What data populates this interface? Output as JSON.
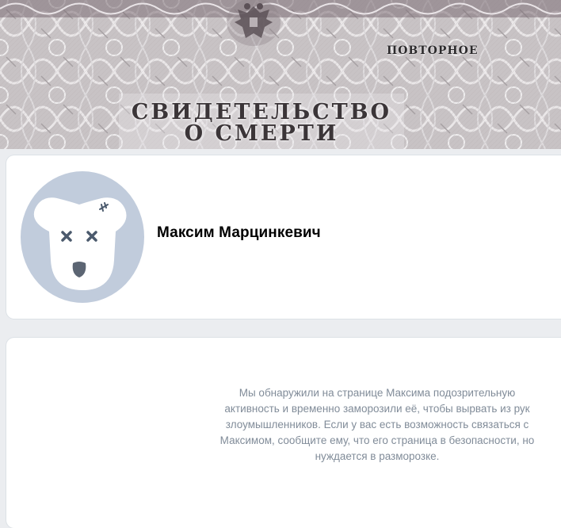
{
  "cover": {
    "stamp": "ПОВТОРНОЕ",
    "title_line1": "СВИДЕТЕЛЬСТВО",
    "title_line2": "О СМЕРТИ",
    "emblem": "double-headed-eagle-icon"
  },
  "profile": {
    "name": "Максим Марцинкевич",
    "avatar": "dead-dog-avatar-icon"
  },
  "notice": {
    "text": "Мы обнаружили на странице Максима подозрительную\nактивность и временно заморозили её, чтобы вырвать из рук\nзлоумышленников. Если у вас есть возможность связаться с\nМаксимом, сообщите ему, что его страница в безопасности, но\nнуждается в разморозке."
  },
  "colors": {
    "page_bg": "#ebedf0",
    "card_bg": "#ffffff",
    "avatar_bg": "#c1ccdc",
    "notice_text": "#818c99",
    "cover_ink": "#3b3538"
  }
}
